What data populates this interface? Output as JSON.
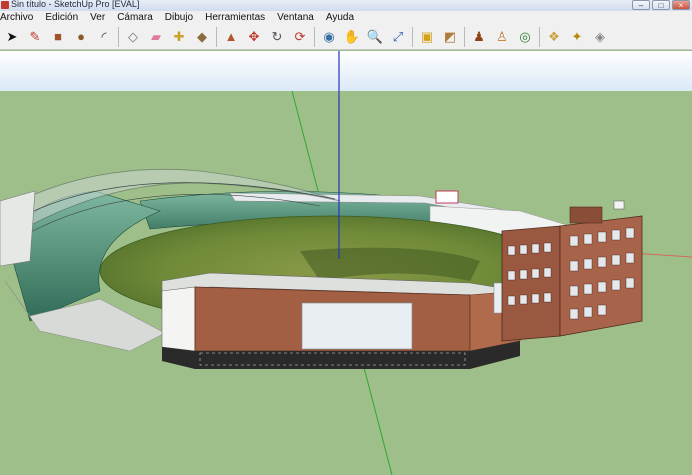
{
  "window": {
    "title": "Sin título - SketchUp Pro [EVAL]",
    "buttons": {
      "minimize": "–",
      "maximize": "□",
      "close": "×"
    }
  },
  "menubar": {
    "items": [
      "Archivo",
      "Edición",
      "Ver",
      "Cámara",
      "Dibujo",
      "Herramientas",
      "Ventana",
      "Ayuda"
    ]
  },
  "toolbar": {
    "tools": [
      {
        "name": "select-icon",
        "glyph": "➤",
        "color": "#111111"
      },
      {
        "name": "pencil-icon",
        "glyph": "✎",
        "color": "#c0392b"
      },
      {
        "name": "rectangle-icon",
        "glyph": "■",
        "color": "#a0522d"
      },
      {
        "name": "circle-icon",
        "glyph": "●",
        "color": "#8b5a2b"
      },
      {
        "name": "arc-icon",
        "glyph": "◜",
        "color": "#333333"
      },
      {
        "name": "sep"
      },
      {
        "name": "make-component-icon",
        "glyph": "◇",
        "color": "#777777"
      },
      {
        "name": "eraser-icon",
        "glyph": "▰",
        "color": "#e07aa0"
      },
      {
        "name": "tape-measure-icon",
        "glyph": "✚",
        "color": "#c9a227"
      },
      {
        "name": "paint-bucket-icon",
        "glyph": "◆",
        "color": "#8a6d3b"
      },
      {
        "name": "sep"
      },
      {
        "name": "push-pull-icon",
        "glyph": "▲",
        "color": "#b5532c"
      },
      {
        "name": "move-icon",
        "glyph": "✥",
        "color": "#c0392b"
      },
      {
        "name": "rotate-icon",
        "glyph": "↻",
        "color": "#555555"
      },
      {
        "name": "offset-icon",
        "glyph": "⟳",
        "color": "#c0392b"
      },
      {
        "name": "sep"
      },
      {
        "name": "orbit-icon",
        "glyph": "◉",
        "color": "#3a6ea5"
      },
      {
        "name": "pan-icon",
        "glyph": "✋",
        "color": "#555555"
      },
      {
        "name": "zoom-icon",
        "glyph": "🔍",
        "color": "#333333"
      },
      {
        "name": "zoom-extents-icon",
        "glyph": "⤢",
        "color": "#2d5da8"
      },
      {
        "name": "sep"
      },
      {
        "name": "previous-view-icon",
        "glyph": "▣",
        "color": "#d4a017"
      },
      {
        "name": "next-view-icon",
        "glyph": "◩",
        "color": "#b07b3c"
      },
      {
        "name": "sep"
      },
      {
        "name": "position-camera-icon",
        "glyph": "♟",
        "color": "#8b4513"
      },
      {
        "name": "walk-icon",
        "glyph": "♙",
        "color": "#c07b2a"
      },
      {
        "name": "look-around-icon",
        "glyph": "◎",
        "color": "#2e7d32"
      },
      {
        "name": "sep"
      },
      {
        "name": "components-icon",
        "glyph": "❖",
        "color": "#caa13a"
      },
      {
        "name": "materials-icon",
        "glyph": "✦",
        "color": "#b8860b"
      },
      {
        "name": "styles-icon",
        "glyph": "◈",
        "color": "#888888"
      }
    ]
  },
  "viewport": {
    "sky_color": "#e8f1fb",
    "ground_color": "#9fbf8a",
    "axis_colors": {
      "red": "#d06a5a",
      "green": "#30a830",
      "blue": "#2535c0"
    }
  }
}
